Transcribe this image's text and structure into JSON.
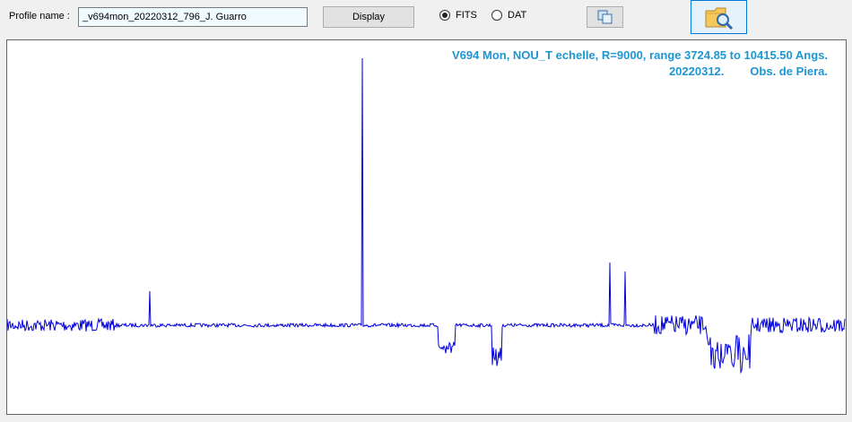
{
  "profile": {
    "label": "Profile name :",
    "value": "_v694mon_20220312_796_J. Guarro"
  },
  "toolbar": {
    "display_label": "Display",
    "copy_icon": "copy-icon",
    "open_icon": "folder-search-icon"
  },
  "format": {
    "options": [
      "FITS",
      "DAT"
    ],
    "selected": "FITS"
  },
  "plot": {
    "title_line1": "V694 Mon, NOU_T echelle, R=9000, range 3724.85 to 10415.50 Angs.",
    "title_line2": "20220312.        Obs. de Piera.",
    "title_color": "#1e96d2",
    "spectrum_color": "#0000dd"
  },
  "chart_data": {
    "type": "line",
    "series": [
      {
        "values": []
      }
    ],
    "x_range": [
      3724.85,
      10415.5
    ],
    "grid": false
  }
}
